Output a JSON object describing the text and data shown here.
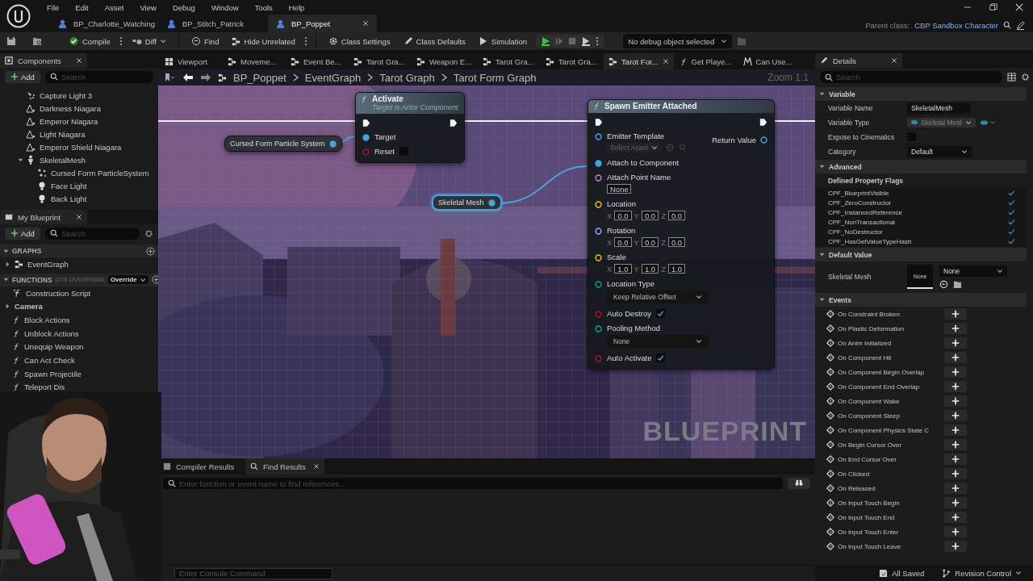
{
  "menu": [
    "File",
    "Edit",
    "Asset",
    "View",
    "Debug",
    "Window",
    "Tools",
    "Help"
  ],
  "document_tabs": [
    {
      "label": "BP_Charlotte_Watching",
      "selected": false
    },
    {
      "label": "BP_Stitch_Patrick",
      "selected": false
    },
    {
      "label": "BP_Poppet",
      "selected": true
    }
  ],
  "parent_class": {
    "label": "Parent class:",
    "value": "CBP Sandbox Character"
  },
  "toolbar": {
    "compile": "Compile",
    "diff": "Diff",
    "find": "Find",
    "hide_unrelated": "Hide Unrelated",
    "class_settings": "Class Settings",
    "class_defaults": "Class Defaults",
    "simulation": "Simulation",
    "debug_object": "No debug object selected"
  },
  "components": {
    "title": "Components",
    "add": "Add",
    "search_placeholder": "Search",
    "items": [
      {
        "label": "Capture Light 3",
        "kind": "spot"
      },
      {
        "label": "Darkness Niagara",
        "kind": "niagara"
      },
      {
        "label": "Emperor Niagara",
        "kind": "niagara"
      },
      {
        "label": "Light Niagara",
        "kind": "niagara"
      },
      {
        "label": "Emperor Shield Niagara",
        "kind": "niagara"
      },
      {
        "label": "SkeletalMesh",
        "kind": "mesh",
        "expanded": true,
        "children": [
          {
            "label": "Cursed Form ParticleSystem",
            "kind": "particle"
          },
          {
            "label": "Face Light",
            "kind": "bulb"
          },
          {
            "label": "Back Light",
            "kind": "bulb"
          }
        ]
      }
    ]
  },
  "my_blueprint": {
    "title": "My Blueprint",
    "add": "Add",
    "search_placeholder": "Search",
    "graphs": {
      "title": "GRAPHS",
      "items": [
        {
          "label": "EventGraph",
          "expanded": false
        }
      ]
    },
    "functions": {
      "title": "FUNCTIONS",
      "note": "(276 OVERRIDAE",
      "override": "Override",
      "items": [
        {
          "label": "Construction Script",
          "kind": "construction"
        },
        {
          "label": "Camera",
          "kind": "category",
          "expanded": false
        },
        {
          "label": "Block Actions",
          "kind": "function"
        },
        {
          "label": "Unblock Actions",
          "kind": "function"
        },
        {
          "label": "Unequip Weapon",
          "kind": "function"
        },
        {
          "label": "Can Act Check",
          "kind": "function"
        },
        {
          "label": "Spawn Projectile",
          "kind": "function"
        },
        {
          "label": "Teleport Dis",
          "kind": "function"
        }
      ]
    }
  },
  "graph_tabs": [
    {
      "label": "Viewport",
      "kind": "viewport",
      "selected": false
    },
    {
      "label": "Moveme...",
      "kind": "graph",
      "selected": false
    },
    {
      "label": "Event Be...",
      "kind": "graph",
      "selected": false
    },
    {
      "label": "Tarot Gra...",
      "kind": "graph",
      "selected": false
    },
    {
      "label": "Weapon E...",
      "kind": "graph",
      "selected": false
    },
    {
      "label": "Tarot Gra...",
      "kind": "graph",
      "selected": false
    },
    {
      "label": "Tarot Gra...",
      "kind": "graph",
      "selected": false
    },
    {
      "label": "Tarot For...",
      "kind": "graph",
      "selected": true
    },
    {
      "label": "Get Playe...",
      "kind": "function",
      "selected": false
    },
    {
      "label": "Can Use...",
      "kind": "macro",
      "selected": false
    }
  ],
  "breadcrumb": [
    "BP_Poppet",
    "EventGraph",
    "Tarot Graph",
    "Tarot Form Graph"
  ],
  "zoom": "Zoom 1:1",
  "graph": {
    "watermark": "BLUEPRINT",
    "nodes": [
      {
        "kind": "variable",
        "label": "Cursed Form Particle System",
        "selected": false,
        "color": "#4aa3d9"
      },
      {
        "kind": "function",
        "title": "Activate",
        "subtitle": "Target is Actor Component",
        "selected": false,
        "pins": [
          {
            "kind": "object",
            "label": "Target",
            "connected": true,
            "color": "#4aa3d9"
          },
          {
            "kind": "bool",
            "label": "Reset",
            "connected": false,
            "checked": false,
            "color": "#a01830"
          }
        ]
      },
      {
        "kind": "variable",
        "label": "Skeletal Mesh",
        "selected": true,
        "color": "#4aa3d9"
      },
      {
        "kind": "function",
        "title": "Spawn Emitter Attached",
        "selected": false,
        "pins": [
          {
            "kind": "asset",
            "label": "Emitter Template",
            "value": "Select Asset",
            "connected": false,
            "color": "#4aa3d9"
          },
          {
            "kind": "object",
            "label": "Attach to Component",
            "connected": true,
            "color": "#4aa3d9"
          },
          {
            "kind": "name",
            "label": "Attach Point Name",
            "value": "None",
            "connected": false,
            "color": "#c27fe0"
          },
          {
            "kind": "vector",
            "label": "Location",
            "connected": false,
            "color": "#e6c02a",
            "fields": [
              {
                "axis": "X",
                "value": "0.0"
              },
              {
                "axis": "Y",
                "value": "0.0"
              },
              {
                "axis": "Z",
                "value": "0.0"
              }
            ]
          },
          {
            "kind": "vector",
            "label": "Rotation",
            "connected": false,
            "color": "#a3a6f0",
            "fields": [
              {
                "axis": "X",
                "value": "0.0"
              },
              {
                "axis": "Y",
                "value": "0.0"
              },
              {
                "axis": "Z",
                "value": "0.0"
              }
            ]
          },
          {
            "kind": "vector",
            "label": "Scale",
            "connected": false,
            "color": "#e6c02a",
            "fields": [
              {
                "axis": "X",
                "value": "1.0"
              },
              {
                "axis": "Y",
                "value": "1.0"
              },
              {
                "axis": "Z",
                "value": "1.0"
              }
            ]
          },
          {
            "kind": "enum",
            "label": "Location Type",
            "value": "Keep Relative Offset",
            "connected": false,
            "color": "#13a08c"
          },
          {
            "kind": "bool",
            "label": "Auto Destroy",
            "checked": true,
            "connected": false,
            "color": "#a01830"
          },
          {
            "kind": "enum",
            "label": "Pooling Method",
            "value": "None",
            "connected": false,
            "color": "#13a08c"
          },
          {
            "kind": "bool",
            "label": "Auto Activate",
            "checked": true,
            "connected": false,
            "color": "#a01830"
          }
        ],
        "outputs": [
          {
            "label": "Return Value",
            "connected": false,
            "color": "#4aa3d9"
          }
        ]
      }
    ]
  },
  "results": {
    "tabs": [
      {
        "label": "Compiler Results",
        "selected": false
      },
      {
        "label": "Find Results",
        "selected": true
      }
    ],
    "search_placeholder": "Enter function or event name to find references..."
  },
  "console_placeholder": "Enter Console Command",
  "details": {
    "title": "Details",
    "search_placeholder": "Search",
    "variable": {
      "title": "Variable",
      "rows": [
        {
          "kind": "text",
          "label": "Variable Name",
          "value": "SkeletalMesh"
        },
        {
          "kind": "type",
          "label": "Variable Type",
          "value": "Skeletal Mesl"
        },
        {
          "kind": "checkbox",
          "label": "Expose to Cinematics",
          "checked": false
        },
        {
          "kind": "dropdown",
          "label": "Category",
          "value": "Default"
        }
      ]
    },
    "advanced": {
      "title": "Advanced",
      "flags_title": "Defined Property Flags",
      "flags": [
        {
          "label": "CPF_BlueprintVisible",
          "checked": true
        },
        {
          "label": "CPF_ZeroConstructor",
          "checked": true
        },
        {
          "label": "CPF_InstancedReference",
          "checked": true
        },
        {
          "label": "CPF_NonTransactional",
          "checked": true
        },
        {
          "label": "CPF_NoDestructor",
          "checked": true
        },
        {
          "label": "CPF_HasGetValueTypeHash",
          "checked": true
        }
      ]
    },
    "default_value": {
      "title": "Default Value",
      "label": "Skeletal Mesh",
      "thumbnail": "None",
      "value": "None"
    },
    "events": {
      "title": "Events",
      "items": [
        "On Constraint Broken",
        "On Plastic Deformation",
        "On Anim Initialized",
        "On Component Hit",
        "On Component Begin Overlap",
        "On Component End Overlap",
        "On Component Wake",
        "On Component Sleep",
        "On Component Physics State C",
        "On Begin Cursor Over",
        "On End Cursor Over",
        "On Clicked",
        "On Released",
        "On Input Touch Begin",
        "On Input Touch End",
        "On Input Touch Enter",
        "On Input Touch Leave"
      ]
    }
  },
  "status": {
    "saved": "All Saved",
    "revision_control": "Revision Control"
  }
}
